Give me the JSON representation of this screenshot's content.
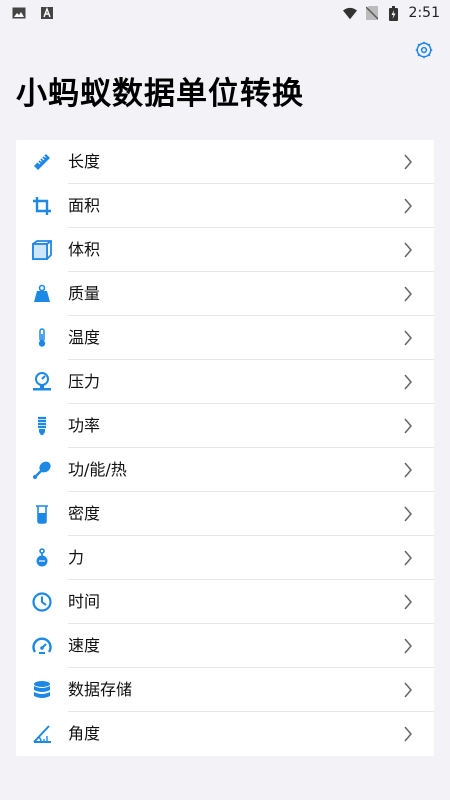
{
  "status_bar": {
    "time": "2:51",
    "left_icons": [
      "image-icon",
      "a-icon"
    ],
    "right_icons": [
      "wifi-icon",
      "no-sim-icon",
      "battery-icon"
    ]
  },
  "header": {
    "title": "小蚂蚁数据单位转换",
    "settings_icon": "gear-icon"
  },
  "accent_color": "#1e88e5",
  "categories": [
    {
      "label": "长度",
      "icon": "ruler-icon"
    },
    {
      "label": "面积",
      "icon": "crop-icon"
    },
    {
      "label": "体积",
      "icon": "cube-icon"
    },
    {
      "label": "质量",
      "icon": "weight-icon"
    },
    {
      "label": "温度",
      "icon": "thermometer-icon"
    },
    {
      "label": "压力",
      "icon": "pressure-gauge-icon"
    },
    {
      "label": "功率",
      "icon": "bulb-icon"
    },
    {
      "label": "功/能/热",
      "icon": "drumstick-icon"
    },
    {
      "label": "密度",
      "icon": "beaker-icon"
    },
    {
      "label": "力",
      "icon": "hanging-weight-icon"
    },
    {
      "label": "时间",
      "icon": "clock-icon"
    },
    {
      "label": "速度",
      "icon": "speedometer-icon"
    },
    {
      "label": "数据存储",
      "icon": "database-icon"
    },
    {
      "label": "角度",
      "icon": "angle-icon"
    }
  ]
}
